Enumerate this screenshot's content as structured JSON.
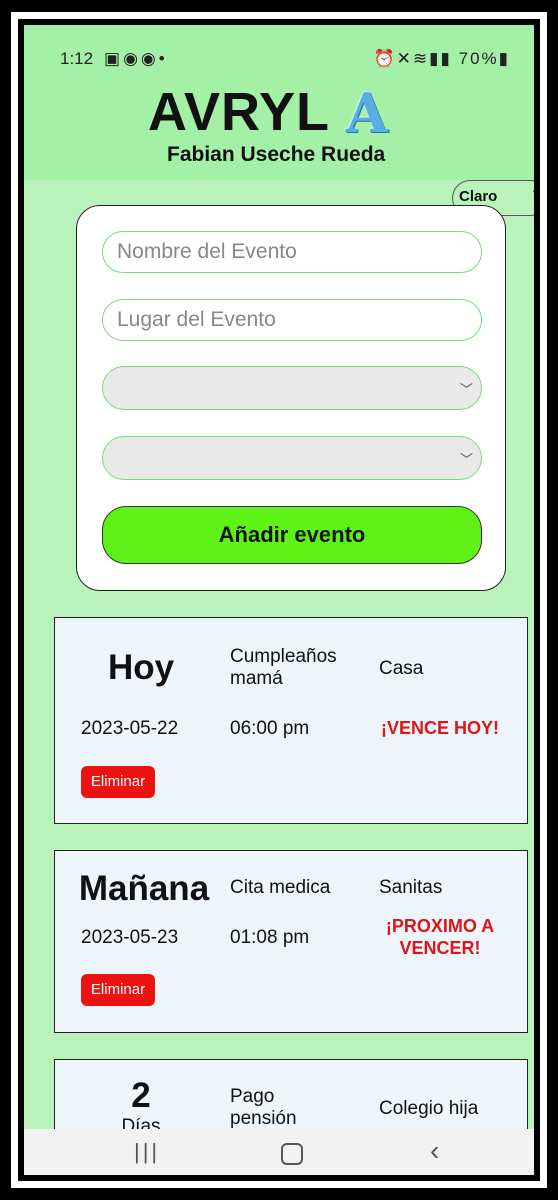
{
  "status_bar": {
    "time": "1:12",
    "left_icons": [
      "image-icon",
      "chrome-icon",
      "chrome-icon",
      "dot-icon"
    ],
    "right_icons": [
      "alarm-icon",
      "mute-icon",
      "wifi-icon",
      "signal-icon",
      "signal-icon"
    ],
    "battery": "70%"
  },
  "header": {
    "title": "AVRYL",
    "logo_letter": "A",
    "subtitle": "Fabian Useche Rueda"
  },
  "theme": {
    "selected": "Claro"
  },
  "form": {
    "name_placeholder": "Nombre del Evento",
    "place_placeholder": "Lugar del Evento",
    "select1_value": "",
    "select2_value": "",
    "add_label": "Añadir evento"
  },
  "events": [
    {
      "day": "Hoy",
      "name": "Cumpleaños mamá",
      "place": "Casa",
      "date": "2023-05-22",
      "time": "06:00 pm",
      "status": "¡VENCE HOY!",
      "delete_label": "Eliminar"
    },
    {
      "day": "Mañana",
      "name": "Cita medica",
      "place": "Sanitas",
      "date": "2023-05-23",
      "time": "01:08 pm",
      "status": "¡PROXIMO A VENCER!",
      "delete_label": "Eliminar"
    },
    {
      "day": "2",
      "day_sub": "Días",
      "name": "Pago pensión",
      "place": "Colegio hija"
    }
  ],
  "colors": {
    "header_bg": "#a3f0a6",
    "page_bg": "#b9f2bb",
    "add_button": "#5ef217",
    "delete_button": "#ee1111",
    "status_text": "#e01515",
    "card_bg": "#eef5fb"
  },
  "nav": {
    "recent_icon": "recent-apps-icon",
    "home_icon": "home-icon",
    "back_icon": "back-icon"
  }
}
